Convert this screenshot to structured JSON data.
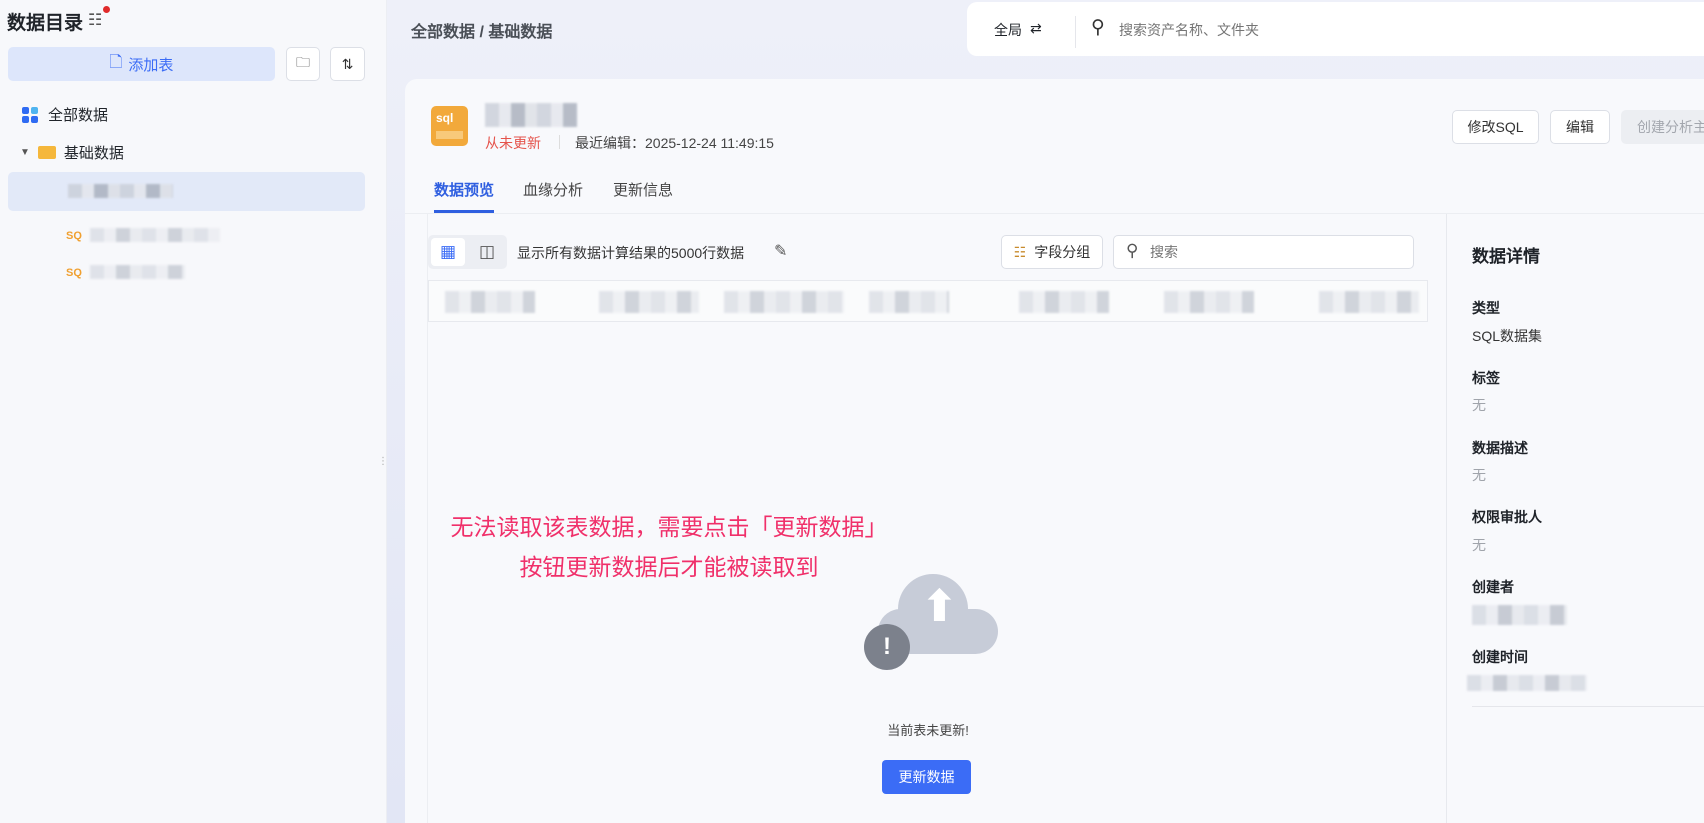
{
  "sidebar": {
    "title": "数据目录",
    "add_table": "添加表",
    "tree": {
      "all": "全部数据",
      "folder": "基础数据"
    }
  },
  "header": {
    "breadcrumb": "全部数据 / 基础数据",
    "scope": "全局",
    "search_placeholder": "搜索资产名称、文件夹"
  },
  "dataset": {
    "status": "从未更新",
    "last_edit": "最近编辑：2025-12-24 11:49:15",
    "actions": {
      "edit_sql": "修改SQL",
      "edit": "编辑",
      "create_analysis": "创建分析主题"
    },
    "tabs": [
      "数据预览",
      "血缘分析",
      "更新信息"
    ]
  },
  "preview": {
    "row_info": "显示所有数据计算结果的5000行数据",
    "field_group": "字段分组",
    "search_placeholder": "搜索",
    "annotation": "无法读取该表数据，需要点击「更新数据」按钮更新数据后才能被读取到",
    "empty_text": "当前表未更新!",
    "update_button": "更新数据"
  },
  "details": {
    "title": "数据详情",
    "items": [
      {
        "label": "类型",
        "value": "SQL数据集"
      },
      {
        "label": "标签",
        "value": "无"
      },
      {
        "label": "数据描述",
        "value": "无"
      },
      {
        "label": "权限审批人",
        "value": "无"
      },
      {
        "label": "创建者"
      },
      {
        "label": "创建时间"
      }
    ]
  },
  "colors": {
    "accent": "#3b6cf6",
    "annotation": "#f0306a",
    "status_never": "#e5534b"
  }
}
